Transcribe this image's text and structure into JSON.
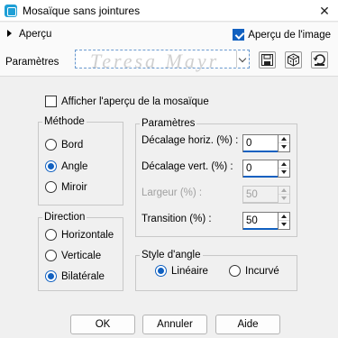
{
  "window": {
    "title": "Mosaïque sans jointures",
    "close_symbol": "✕"
  },
  "top": {
    "preview_label": "Aperçu",
    "preview_image_label": "Aperçu de l'image",
    "preview_image_checked": true,
    "params_label": "Paramètres",
    "preset_value": "",
    "watermark_text": "Teresa Mayr"
  },
  "options": {
    "show_mosaic_preview_label": "Afficher l'aperçu de la mosaïque",
    "show_mosaic_preview_checked": false
  },
  "methode": {
    "title": "Méthode",
    "options": [
      {
        "label": "Bord",
        "selected": false
      },
      {
        "label": "Angle",
        "selected": true
      },
      {
        "label": "Miroir",
        "selected": false
      }
    ]
  },
  "direction": {
    "title": "Direction",
    "options": [
      {
        "label": "Horizontale",
        "selected": false
      },
      {
        "label": "Verticale",
        "selected": false
      },
      {
        "label": "Bilatérale",
        "selected": true
      }
    ]
  },
  "parametres": {
    "title": "Paramètres",
    "fields": [
      {
        "label": "Décalage horiz. (%) :",
        "value": "0",
        "enabled": true
      },
      {
        "label": "Décalage vert. (%) :",
        "value": "0",
        "enabled": true
      },
      {
        "label": "Largeur (%) :",
        "value": "50",
        "enabled": false
      },
      {
        "label": "Transition (%) :",
        "value": "50",
        "enabled": true
      }
    ]
  },
  "style_angle": {
    "title": "Style d'angle",
    "options": [
      {
        "label": "Linéaire",
        "selected": true
      },
      {
        "label": "Incurvé",
        "selected": false
      }
    ]
  },
  "buttons": {
    "ok": "OK",
    "cancel": "Annuler",
    "help": "Aide"
  },
  "colors": {
    "accent": "#1060c0",
    "app_icon": "#1e9fd6"
  }
}
